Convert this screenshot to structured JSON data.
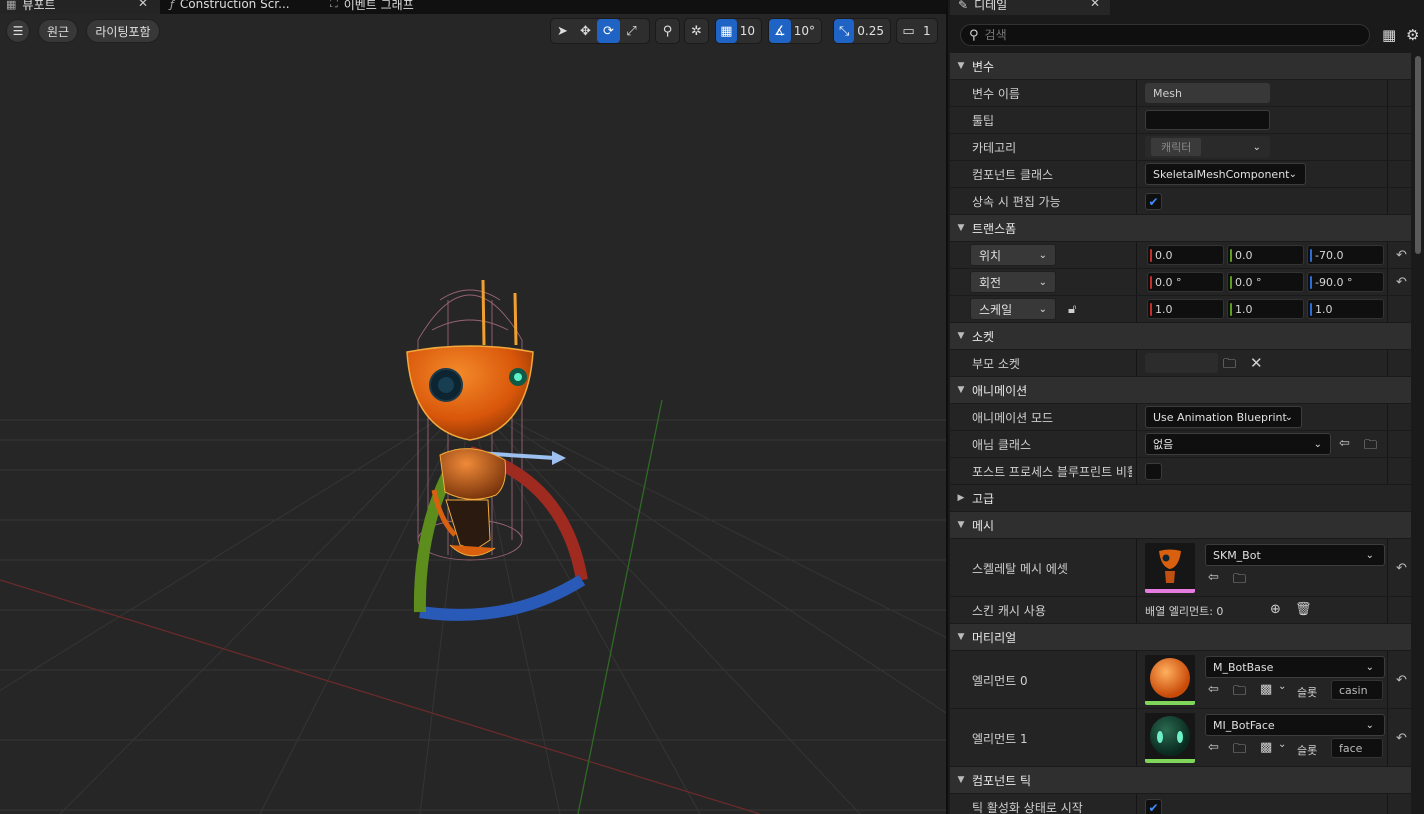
{
  "viewport": {
    "tabs": [
      {
        "label": "뷰포트",
        "icon": "viewport-grid-icon"
      },
      {
        "label": "Construction Scr...",
        "icon": "function-icon"
      },
      {
        "label": "이벤트 그래프",
        "icon": "graph-nodes-icon"
      }
    ],
    "menu_icon": "hamburger-icon",
    "pills": [
      "원근",
      "라이팅포함"
    ],
    "toolbar": {
      "grid_snap": "10",
      "rotation_snap": "10°",
      "scale_snap": "0.25",
      "camera_speed": "1"
    }
  },
  "details": {
    "tab_label": "디테일",
    "search_placeholder": "검색",
    "categories": {
      "variable": "변수",
      "transform": "트랜스폼",
      "socket": "소켓",
      "animation": "애니메이션",
      "advanced": "고급",
      "mesh": "메시",
      "material": "머티리얼",
      "component_tick": "컴포넌트 틱"
    },
    "variable": {
      "name_label": "변수 이름",
      "name_value": "Mesh",
      "tooltip_label": "툴팁",
      "tooltip_value": "",
      "category_label": "카테고리",
      "category_value": "캐릭터",
      "component_class_label": "컴포넌트 클래스",
      "component_class_value": "SkeletalMeshComponent",
      "editable_label": "상속 시 편집 가능",
      "editable_checked": true
    },
    "transform": {
      "location": {
        "label": "위치",
        "x": "0.0",
        "y": "0.0",
        "z": "-70.0"
      },
      "rotation": {
        "label": "회전",
        "x": "0.0 °",
        "y": "0.0 °",
        "z": "-90.0 °"
      },
      "scale": {
        "label": "스케일",
        "x": "1.0",
        "y": "1.0",
        "z": "1.0"
      }
    },
    "socket": {
      "parent_label": "부모 소켓",
      "parent_value": ""
    },
    "animation": {
      "mode_label": "애니메이션 모드",
      "mode_value": "Use Animation Blueprint",
      "class_label": "애님 클래스",
      "class_value": "없음",
      "postprocess_label": "포스트 프로세스 블루프린트 비활...",
      "postprocess_checked": false
    },
    "mesh": {
      "asset_label": "스켈레탈 메시 에셋",
      "asset_value": "SKM_Bot",
      "skin_cache_label": "스킨 캐시 사용",
      "skin_cache_value": "배열 엘리먼트: 0"
    },
    "material": {
      "slot_label": "슬롯",
      "elements": [
        {
          "label": "엘리먼트 0",
          "value": "M_BotBase",
          "slot": "casin"
        },
        {
          "label": "엘리먼트 1",
          "value": "MI_BotFace",
          "slot": "face"
        }
      ]
    },
    "tick": {
      "start_label": "틱 활성화 상태로 시작",
      "start_checked": true
    }
  },
  "colors": {
    "accent": "#1f63c5",
    "axis_x": "#c4302b",
    "axis_y": "#5f9e22",
    "axis_z": "#2f6dd6",
    "robot_orange": "#e2630e",
    "selection": "#f2a93b"
  }
}
